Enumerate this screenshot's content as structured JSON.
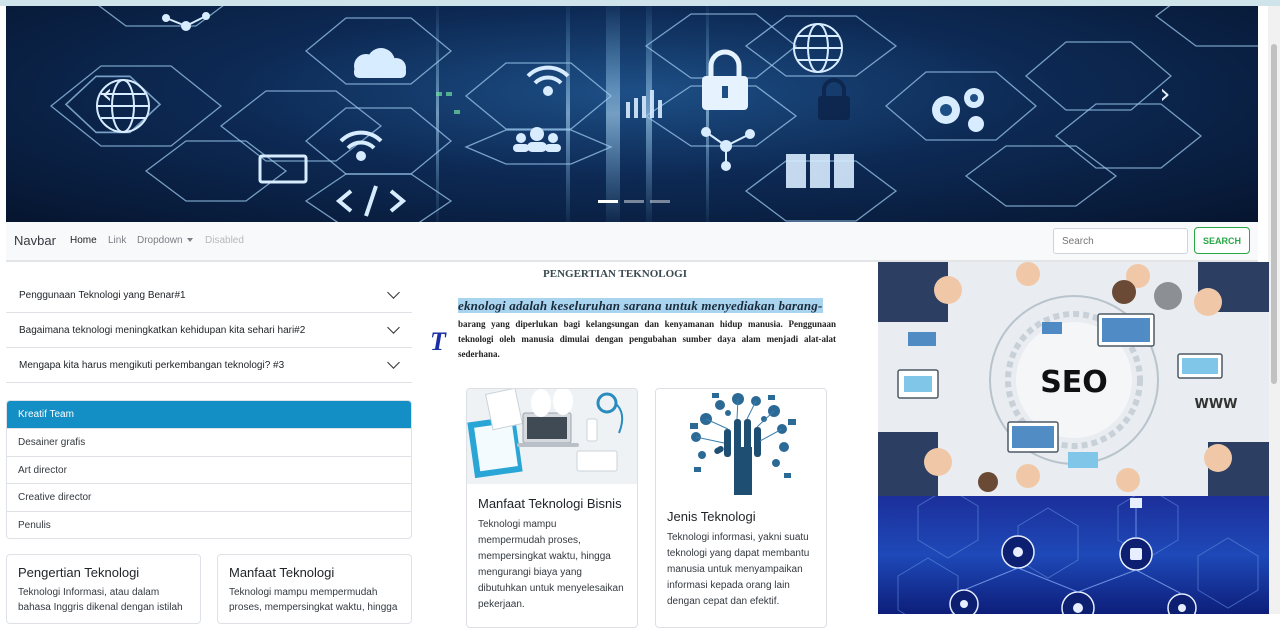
{
  "navbar": {
    "brand": "Navbar",
    "links": [
      {
        "label": "Home"
      },
      {
        "label": "Link"
      },
      {
        "label": "Dropdown"
      },
      {
        "label": "Disabled"
      }
    ],
    "search_placeholder": "Search",
    "search_button": "SEARCH"
  },
  "carousel": {
    "slide_count": 3,
    "active_slide": 1,
    "icons": [
      "globe-icon",
      "cloud-icon",
      "wifi-icon",
      "lock-icon",
      "gears-icon",
      "people-icon",
      "code-icon",
      "network-icon"
    ]
  },
  "accordion": {
    "items": [
      {
        "label": "Penggunaan Teknologi yang Benar#1"
      },
      {
        "label": "Bagaimana teknologi meningkatkan kehidupan kita sehari hari#2"
      },
      {
        "label": "Mengapa kita harus mengikuti perkembangan teknologi? #3"
      }
    ]
  },
  "team": {
    "items": [
      {
        "label": "Kreatif Team",
        "active": true
      },
      {
        "label": "Desainer grafis"
      },
      {
        "label": "Art director"
      },
      {
        "label": "Creative director"
      },
      {
        "label": "Penulis"
      }
    ]
  },
  "bottom_cards": [
    {
      "title": "Pengertian Teknologi",
      "text": "Teknologi Informasi, atau dalam bahasa Inggris dikenal dengan istilah"
    },
    {
      "title": "Manfaat Teknologi",
      "text": "Teknologi mampu mempermudah proses, mempersingkat waktu, hingga"
    }
  ],
  "article": {
    "title": "PENGERTIAN TEKNOLOGI",
    "dropcap": "T",
    "lead": "eknologi adalah keseluruhan sarana untuk menyediakan barang-",
    "body": "barang yang diperlukan bagi kelangsungan dan kenyamanan hidup manusia. Penggunaan teknologi oleh manusia dimulai dengan pengubahan sumber daya alam menjadi alat-alat sederhana."
  },
  "cards": [
    {
      "title": "Manfaat Teknologi Bisnis",
      "text": "Teknologi mampu mempermudah proses, mempersingkat waktu, hingga mengurangi biaya yang dibutuhkan untuk menyelesaikan pekerjaan."
    },
    {
      "title": "Jenis Teknologi",
      "text": "Teknologi informasi, yakni suatu teknologi yang dapat membantu manusia untuk menyampaikan informasi kepada orang lain dengan cepat dan efektif."
    }
  ],
  "right_image": {
    "seo_text": "SEO",
    "www_text": "WWW"
  },
  "colors": {
    "accent_blue": "#138fc5",
    "success_green": "#28a745",
    "dropcap_blue": "#1a2fa5",
    "highlight": "#a9d4ef"
  }
}
